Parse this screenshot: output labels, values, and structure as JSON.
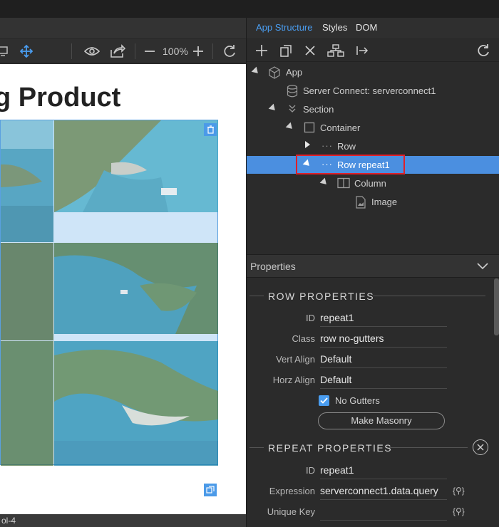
{
  "canvas": {
    "heading": "g Product",
    "zoom": "100%"
  },
  "statusbar": {
    "text": "ol-4"
  },
  "right_panel": {
    "tabs": [
      {
        "label": "App Structure",
        "active": true
      },
      {
        "label": "Styles",
        "active": false
      },
      {
        "label": "DOM",
        "active": false
      }
    ],
    "tree": [
      {
        "label": "App",
        "icon": "cube-icon"
      },
      {
        "label": "Server Connect: serverconnect1",
        "icon": "database-icon"
      },
      {
        "label": "Section",
        "icon": "chevrons-down-icon"
      },
      {
        "label": "Container",
        "icon": "square-icon"
      },
      {
        "label": "Row",
        "icon": "dots-icon"
      },
      {
        "label": "Row repeat1",
        "icon": "dots-icon",
        "selected": true
      },
      {
        "label": "Column",
        "icon": "columns-icon"
      },
      {
        "label": "Image",
        "icon": "image-file-icon"
      }
    ],
    "properties_header": "Properties",
    "row_properties": {
      "title": "ROW PROPERTIES",
      "id_label": "ID",
      "id_value": "repeat1",
      "class_label": "Class",
      "class_value": "row no-gutters",
      "vert_align_label": "Vert Align",
      "vert_align_value": "Default",
      "horz_align_label": "Horz Align",
      "horz_align_value": "Default",
      "no_gutters_label": "No Gutters",
      "no_gutters_checked": true,
      "masonry_button": "Make Masonry"
    },
    "repeat_properties": {
      "title": "REPEAT PROPERTIES",
      "id_label": "ID",
      "id_value": "repeat1",
      "expression_label": "Expression",
      "expression_value": "serverconnect1.data.query",
      "unique_key_label": "Unique Key",
      "unique_key_value": "",
      "dynamic_button": "{⚲}"
    }
  },
  "colors": {
    "accent": "#4a9df0",
    "selection_row": "#4b8fe0",
    "highlight_border": "#e0202a"
  }
}
